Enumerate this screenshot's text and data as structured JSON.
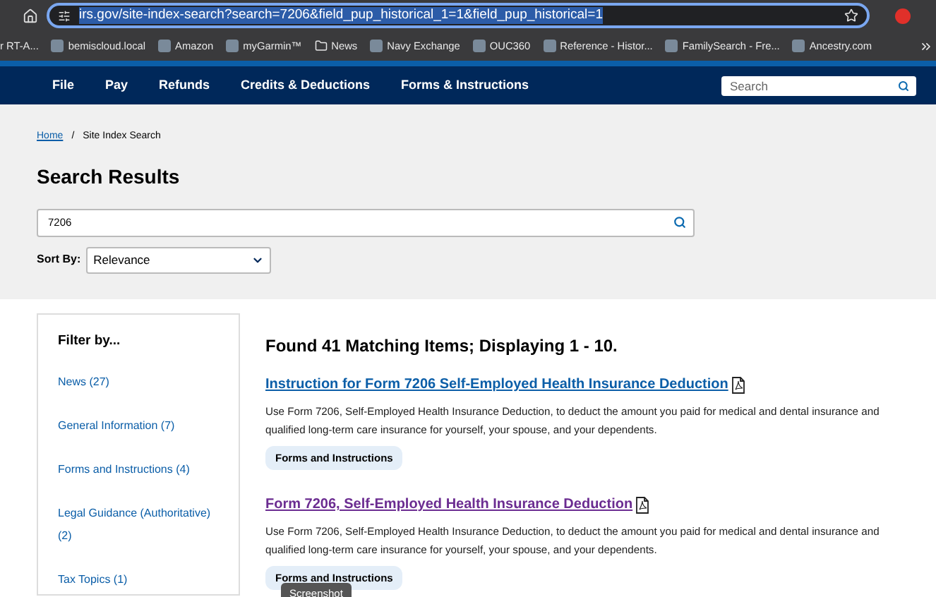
{
  "browser": {
    "url": "irs.gov/site-index-search?search=7206&field_pup_historical_1=1&field_pup_historical=1",
    "bookmarks": [
      "r RT-A...",
      "bemiscloud.local",
      "Amazon",
      "myGarmin™",
      "News",
      "Navy Exchange",
      "OUC360",
      "Reference - Histor...",
      "FamilySearch - Fre...",
      "Ancestry.com"
    ]
  },
  "nav": {
    "items": [
      "File",
      "Pay",
      "Refunds",
      "Credits & Deductions",
      "Forms & Instructions"
    ],
    "search": {
      "placeholder": "Search"
    }
  },
  "breadcrumb": [
    "Home",
    "/",
    "Site Index Search"
  ],
  "title": "Search Results",
  "search": {
    "value": "7206"
  },
  "sort": {
    "label": "Sort By:",
    "value": "Relevance"
  },
  "filter": {
    "title": "Filter by...",
    "items": [
      "News (27)",
      "General Information (7)",
      "Forms and Instructions (4)",
      "Legal Guidance (Authoritative) (2)",
      "Tax Topics (1)"
    ]
  },
  "results_heading": "Found 41 Matching Items; Displaying 1 - 10.",
  "results": [
    {
      "title": "Instruction for Form 7206 Self-Employed Health Insurance Deduction",
      "visited": false,
      "description": "Use Form 7206, Self-Employed Health Insurance Deduction, to deduct the amount you paid for medical and dental insurance and qualified long-term care insurance for yourself, your spouse, and your dependents.",
      "tag": "Forms and Instructions"
    },
    {
      "title": "Form 7206, Self-Employed Health Insurance Deduction",
      "visited": true,
      "description": "Use Form 7206, Self-Employed Health Insurance Deduction, to deduct the amount you paid for medical and dental insurance and qualified long-term care insurance for yourself, your spouse, and your dependents.",
      "tag": "Forms and Instructions"
    }
  ],
  "tooltip": "Screenshot"
}
